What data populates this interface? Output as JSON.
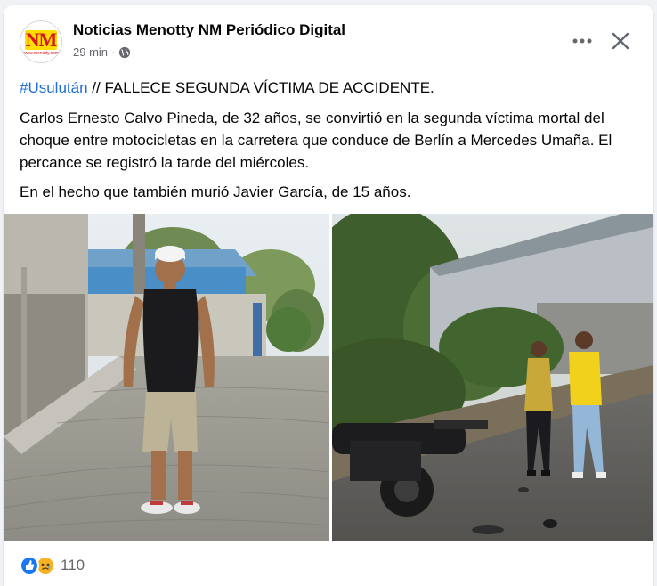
{
  "post": {
    "page_name": "Noticias Menotty NM Periódico Digital",
    "time": "29 min",
    "separator": "·",
    "avatar_logo": "NM",
    "avatar_sub": "www.menotty.com",
    "hashtag": "#Usulután",
    "headline": " // FALLECE SEGUNDA VÍCTIMA DE ACCIDENTE.",
    "paragraph_1": "Carlos Ernesto Calvo Pineda, de 32 años, se convirtió en la segunda víctima mortal del choque entre motocicletas en la carretera que conduce de Berlín a Mercedes Umaña. El percance se registró la tarde del miércoles.",
    "paragraph_2": "En el hecho que también murió Javier García, de 15 años."
  },
  "photos": [
    {
      "icon": "photo-man-standing-street"
    },
    {
      "icon": "photo-motorcycle-accident-scene"
    }
  ],
  "reactions": {
    "icons": [
      "like-icon",
      "sad-icon"
    ],
    "count": "110"
  },
  "colors": {
    "hashtag": "#216fdb",
    "like": "#1877f2",
    "sad": "#f7b125",
    "meta_text": "#65676b"
  }
}
